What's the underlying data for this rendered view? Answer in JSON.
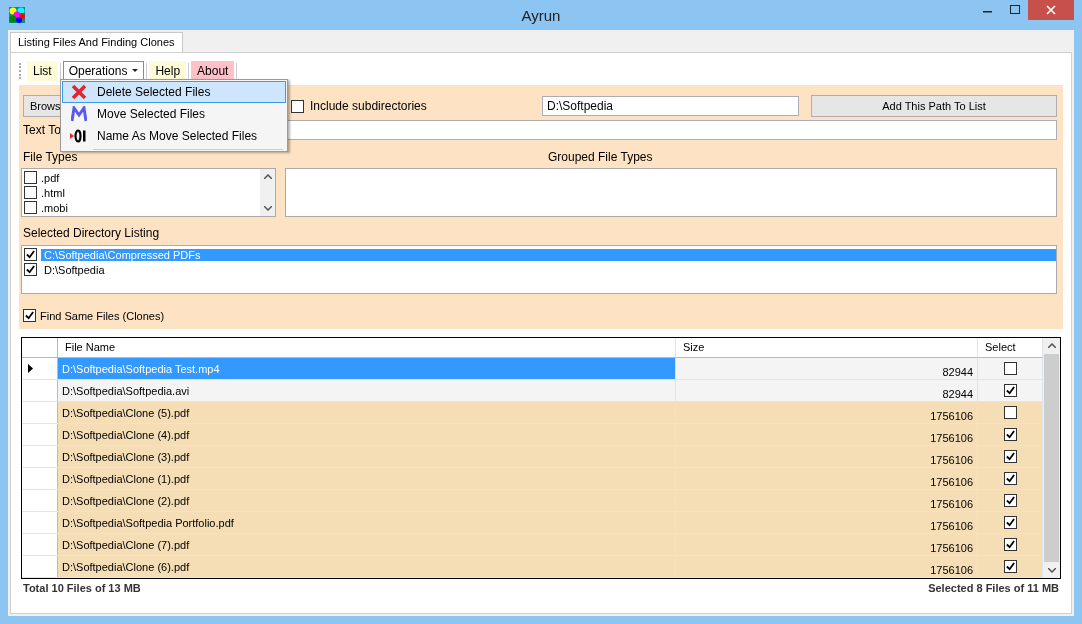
{
  "window": {
    "title": "Ayrun"
  },
  "tabs": [
    {
      "label": "Listing Files And Finding Clones",
      "selected": true
    }
  ],
  "toolbar": [
    {
      "label": "List",
      "open": false,
      "dropdown": false,
      "color": "#fffbd6"
    },
    {
      "label": "Operations",
      "open": true,
      "dropdown": true,
      "color": "#ffffff"
    },
    {
      "label": "Help",
      "open": false,
      "dropdown": false,
      "color": "#fffbd6"
    },
    {
      "label": "About",
      "open": false,
      "dropdown": false,
      "color": "#ffc0c8"
    }
  ],
  "menu": [
    {
      "label": "Delete Selected Files",
      "kind": "delete",
      "selected": true
    },
    {
      "label": "Move Selected Files",
      "kind": "move",
      "selected": false
    },
    {
      "label": "Name As Move Selected Files",
      "kind": "rename",
      "selected": false
    }
  ],
  "browse_button": "Brows",
  "include_subdirectories": {
    "label": "Include subdirectories",
    "checked": false
  },
  "path_field": {
    "value": "D:\\Softpedia"
  },
  "add_path_button": "Add This Path To List",
  "text_to_label": "Text To",
  "file_types": {
    "label": "File Types",
    "items": [
      {
        "label": ".pdf",
        "checked": false
      },
      {
        "label": ".html",
        "checked": false
      },
      {
        "label": ".mobi",
        "checked": false
      }
    ]
  },
  "grouped_file_types": {
    "label": "Grouped File Types"
  },
  "directory_listing": {
    "label": "Selected Directory Listing",
    "items": [
      {
        "label": "C:\\Softpedia\\Compressed PDFs",
        "checked": true,
        "selected": true
      },
      {
        "label": "D:\\Softpedia",
        "checked": true,
        "selected": false
      }
    ]
  },
  "find_same_files": {
    "label": "Find Same Files (Clones)",
    "checked": true
  },
  "table": {
    "columns": [
      "File Name",
      "Size",
      "Select"
    ],
    "rows": [
      {
        "file_name": "D:\\Softpedia\\Softpedia Test.mp4",
        "size": "82944",
        "checked": false,
        "selected": true,
        "clone": false
      },
      {
        "file_name": "D:\\Softpedia\\Softpedia.avi",
        "size": "82944",
        "checked": true,
        "selected": false,
        "clone": false
      },
      {
        "file_name": "D:\\Softpedia\\Clone (5).pdf",
        "size": "1756106",
        "checked": false,
        "selected": false,
        "clone": true
      },
      {
        "file_name": "D:\\Softpedia\\Clone (4).pdf",
        "size": "1756106",
        "checked": true,
        "selected": false,
        "clone": true
      },
      {
        "file_name": "D:\\Softpedia\\Clone (3).pdf",
        "size": "1756106",
        "checked": true,
        "selected": false,
        "clone": true
      },
      {
        "file_name": "D:\\Softpedia\\Clone (1).pdf",
        "size": "1756106",
        "checked": true,
        "selected": false,
        "clone": true
      },
      {
        "file_name": "D:\\Softpedia\\Clone (2).pdf",
        "size": "1756106",
        "checked": true,
        "selected": false,
        "clone": true
      },
      {
        "file_name": "D:\\Softpedia\\Softpedia Portfolio.pdf",
        "size": "1756106",
        "checked": true,
        "selected": false,
        "clone": true
      },
      {
        "file_name": "D:\\Softpedia\\Clone (7).pdf",
        "size": "1756106",
        "checked": true,
        "selected": false,
        "clone": true
      },
      {
        "file_name": "D:\\Softpedia\\Clone (6).pdf",
        "size": "1756106",
        "checked": true,
        "selected": false,
        "clone": true
      }
    ]
  },
  "status_bar": {
    "total": "Total 10 Files of 13 MB",
    "selected": "Selected 8 Files of 11 MB"
  }
}
